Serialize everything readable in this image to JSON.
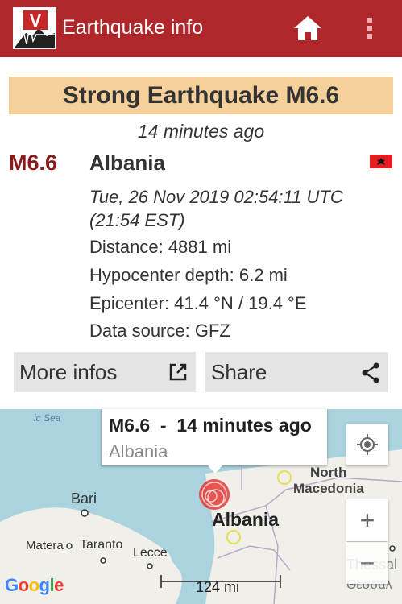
{
  "app": {
    "title": "Earthquake info",
    "logo_letter": "V"
  },
  "event": {
    "banner": "Strong Earthquake M6.6",
    "time_ago": "14 minutes ago",
    "magnitude": "M6.6",
    "region": "Albania",
    "datetime_utc": "Tue, 26 Nov 2019 02:54:11 UTC",
    "datetime_local": "(21:54 EST)",
    "distance": "Distance: 4881 mi",
    "depth": "Hypocenter depth: 6.2 mi",
    "epicenter": "Epicenter: 41.4 °N / 19.4 °E",
    "source": "Data source: GFZ"
  },
  "buttons": {
    "more_infos": "More infos",
    "share": "Share"
  },
  "map": {
    "popup_title": "M6.6  -  14 minutes ago",
    "popup_subtitle": "Albania",
    "labels": {
      "sea": "ic Sea",
      "bari": "Bari",
      "matera": "Matera",
      "taranto": "Taranto",
      "lecce": "Lecce",
      "albania": "Albania",
      "north": "North",
      "macedonia": "Macedonia",
      "thessal": "Thessal",
      "thessal_greek": "Θεσσαλ"
    },
    "scale": "124 mi",
    "attribution": "Google",
    "zoom_in": "+",
    "zoom_out": "−"
  },
  "colors": {
    "appbar": "#b0272b",
    "banner": "#f5d09a",
    "magnitude": "#8b1a1a",
    "quake_marker": "#e53935"
  }
}
